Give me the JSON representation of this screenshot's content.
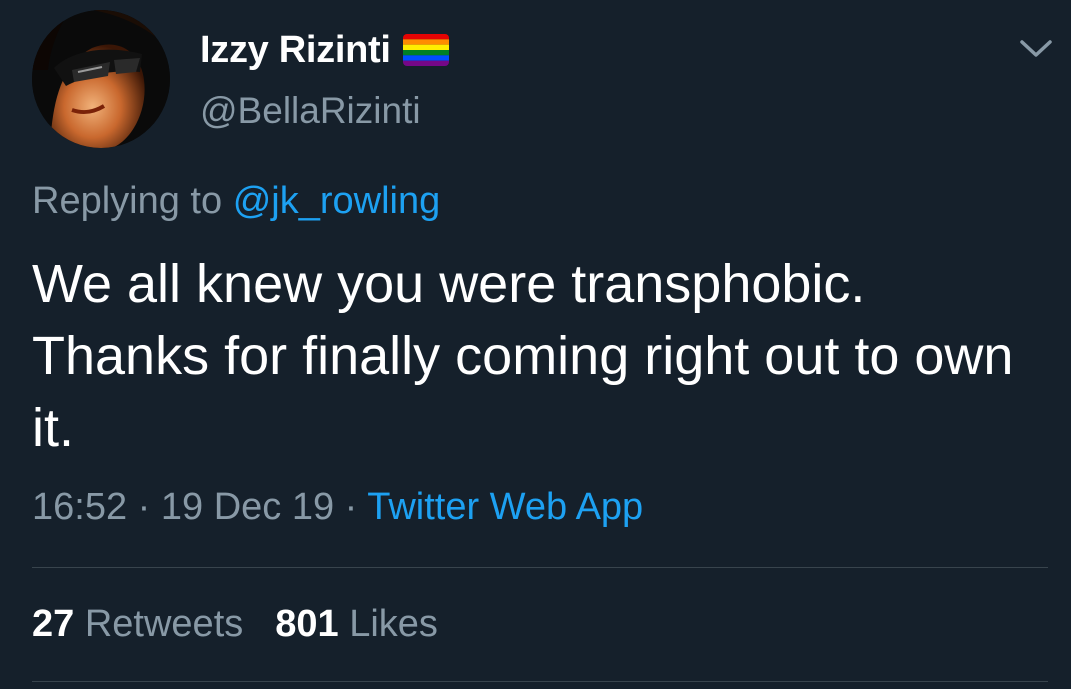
{
  "user": {
    "display_name": "Izzy Rizinti",
    "handle": "@BellaRizinti",
    "avatar_icon": "profile-photo-avatar",
    "flag_icon": "rainbow-flag-emoji"
  },
  "reply": {
    "prefix": "Replying to",
    "mention": "@jk_rowling"
  },
  "tweet": {
    "text": "We all knew you were transphobic. Thanks for finally coming right out to own it."
  },
  "meta": {
    "time": "16:52",
    "separator": "·",
    "date": "19 Dec 19",
    "source": "Twitter Web App"
  },
  "stats": {
    "retweets_count": "27",
    "retweets_label": "Retweets",
    "likes_count": "801",
    "likes_label": "Likes"
  },
  "colors": {
    "background": "#15202b",
    "primary_text": "#ffffff",
    "secondary_text": "#8899a6",
    "accent": "#1da1f2",
    "divider": "#38444d"
  }
}
